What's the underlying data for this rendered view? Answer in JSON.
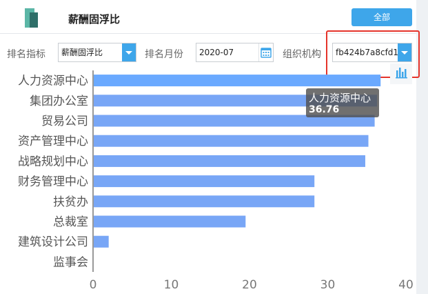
{
  "header": {
    "title": "薪酬固浮比",
    "all_button_label": "全部"
  },
  "filters": {
    "rank_metric": {
      "label": "排名指标",
      "value": "薪酬固浮比"
    },
    "rank_month": {
      "label": "排名月份",
      "value": "2020-07"
    },
    "organization": {
      "label": "组织机构",
      "value": "fb424b7a8cfd1..."
    }
  },
  "icons": {
    "app": "app-logo-icon",
    "dropdown": "chevron-down-icon",
    "calendar": "calendar-icon",
    "chart_switch": "bar-chart-icon"
  },
  "colors": {
    "accent": "#3ea6ea",
    "bar": "#78a6f6",
    "bar_hover": "#6aa9ff",
    "highlight": "#e5332a"
  },
  "tooltip": {
    "name": "人力资源中心",
    "value": "36.76"
  },
  "chart_data": {
    "type": "bar",
    "orientation": "horizontal",
    "categories": [
      "人力资源中心",
      "集团办公室",
      "贸易公司",
      "资产管理中心",
      "战略规划中心",
      "财务管理中心",
      "扶贫办",
      "总裁室",
      "建筑设计公司",
      "监事会"
    ],
    "values": [
      36.76,
      36.3,
      36.0,
      35.2,
      34.8,
      28.3,
      28.3,
      19.5,
      2.0,
      0
    ],
    "xticks": [
      0,
      10,
      20,
      30,
      40
    ],
    "xlim": [
      0,
      40
    ],
    "grid": false,
    "legend": "none"
  }
}
